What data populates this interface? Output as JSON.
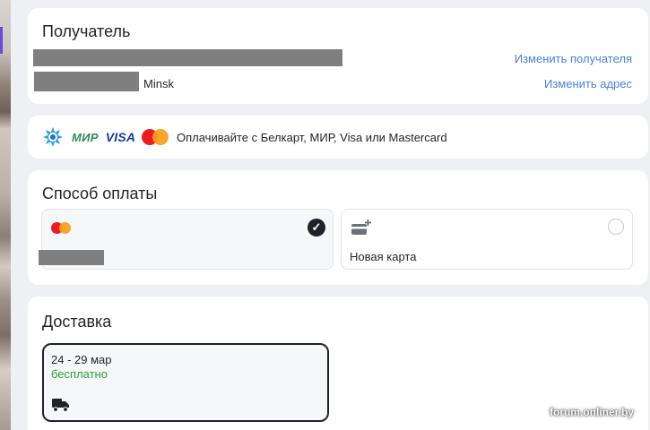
{
  "recipient": {
    "title": "Получатель",
    "city": "Minsk",
    "change_recipient_label": "Изменить получателя",
    "change_address_label": "Изменить адрес"
  },
  "payment_banner": {
    "text": "Оплачивайте с Белкарт, МИР, Visa или Mastercard",
    "logos": [
      "belkart-logo",
      "mir-logo",
      "visa-logo",
      "mastercard-logo"
    ],
    "mir_label": "МИР",
    "visa_label": "VISA"
  },
  "payment_method": {
    "title": "Способ оплаты",
    "options": [
      {
        "icon": "mastercard-logo",
        "selected": true
      },
      {
        "icon": "add-card-icon",
        "label": "Новая карта",
        "selected": false
      }
    ]
  },
  "delivery": {
    "title": "Доставка",
    "option": {
      "dates": "24 - 29 мар",
      "price": "бесплатно",
      "icon": "truck-icon"
    }
  },
  "watermark": "forum.onliner.by",
  "colors": {
    "link": "#4a7fd6",
    "free_price": "#2aa03a",
    "page_background": "#eef0f3",
    "selected_border": "#1f2329"
  }
}
